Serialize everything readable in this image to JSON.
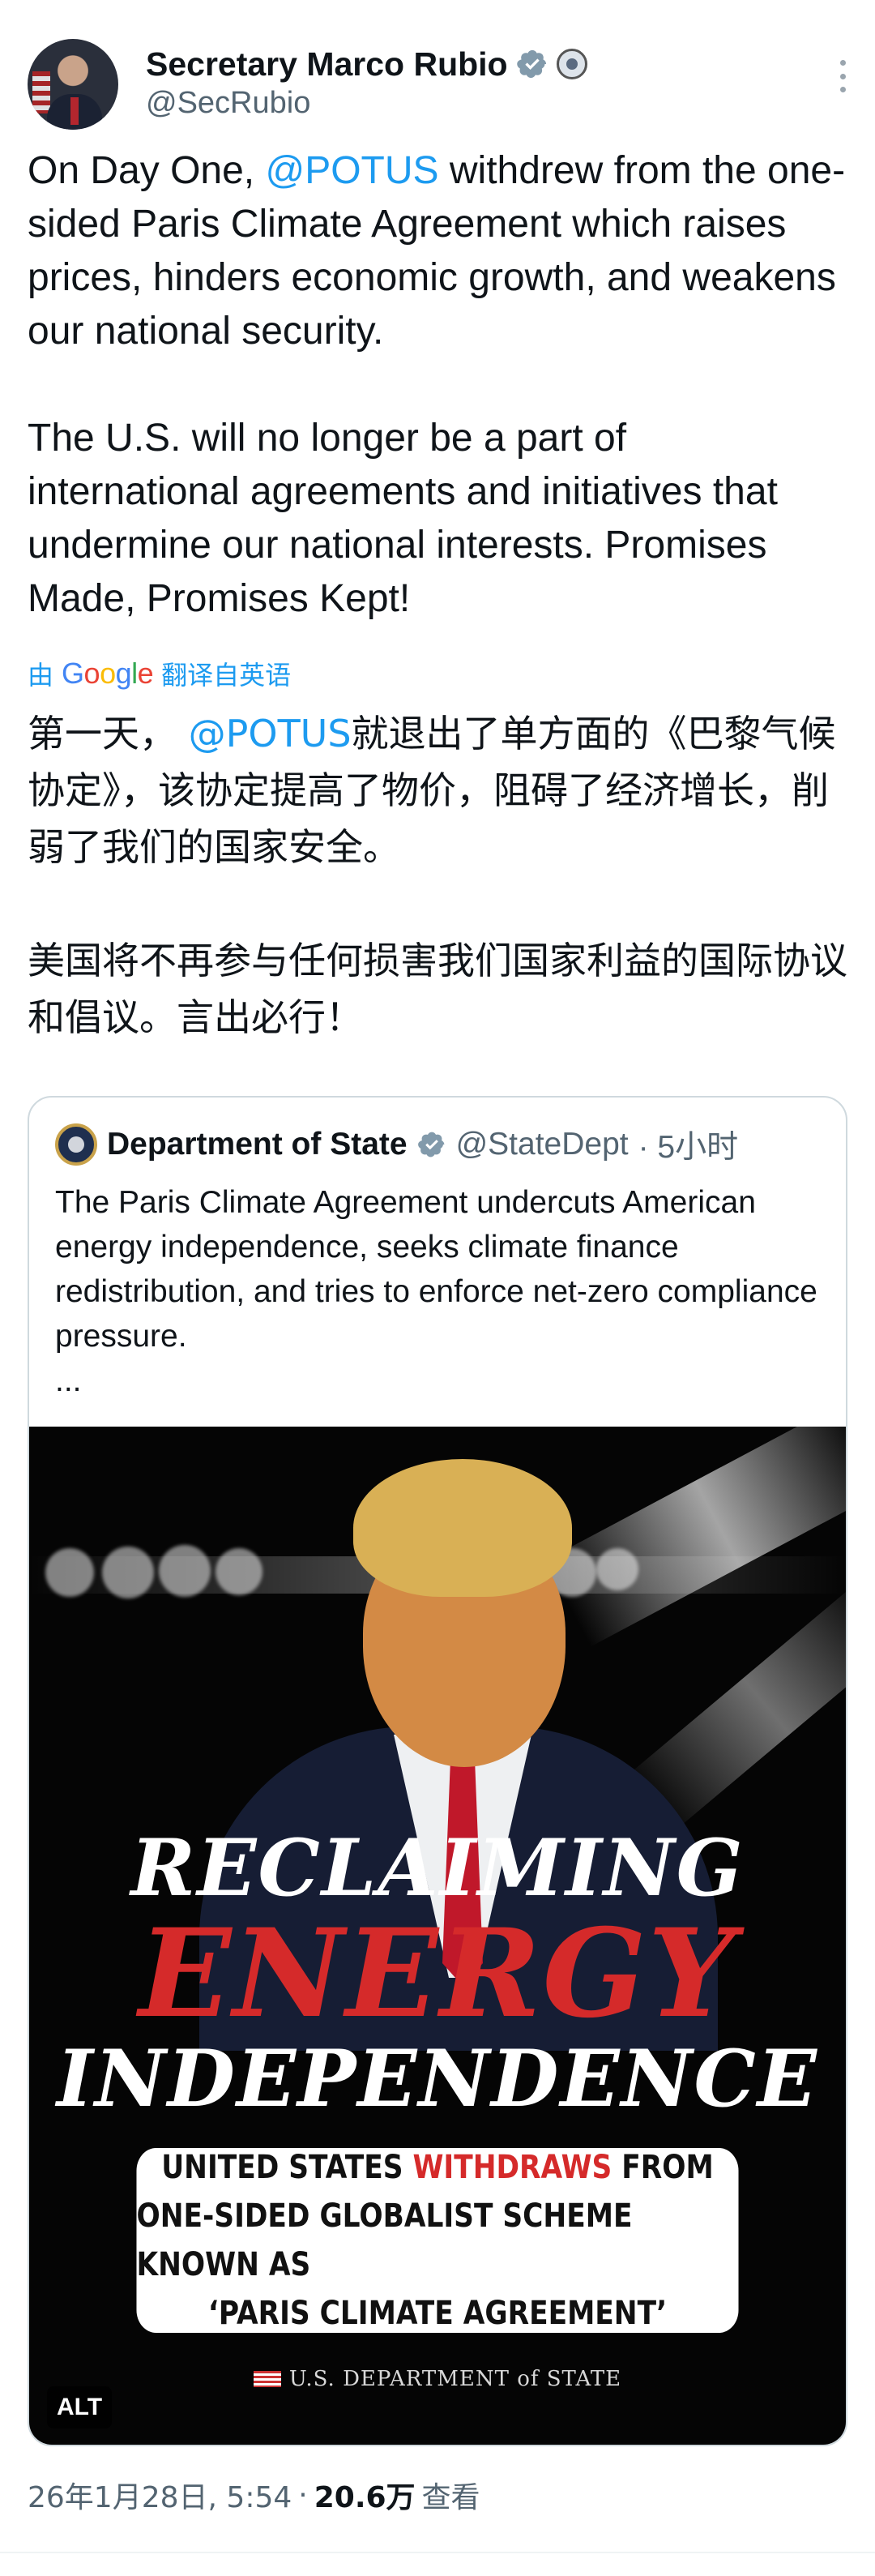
{
  "author": {
    "name": "Secretary Marco Rubio",
    "handle": "@SecRubio"
  },
  "tweet": {
    "line1_pre": "On Day One, ",
    "mention": "@POTUS",
    "line1_post": " withdrew from the one-sided Paris Climate Agreement which raises prices, hinders economic growth, and weakens our national security.\n\nThe U.S. will no longer be a part of international agreements and initiatives that undermine our national interests. Promises Made, Promises Kept!"
  },
  "translation": {
    "by": "由",
    "google": "Google",
    "label": "翻译自英语"
  },
  "translated_text": {
    "pre": "第一天， ",
    "mention": "@POTUS",
    "post": "就退出了单方面的《巴黎气候协定》，该协定提高了物价，阻碍了经济增长，削弱了我们的国家安全。\n\n美国将不再参与任何损害我们国家利益的国际协议和倡议。言出必行！"
  },
  "quoted": {
    "name": "Department of State",
    "handle": "@StateDept",
    "time": "· 5小时",
    "text": "The Paris Climate Agreement undercuts American energy independence, seeks climate finance redistribution, and tries to enforce net-zero compliance pressure.\n...",
    "media": {
      "headline_1": "RECLAIMING",
      "headline_2": "ENERGY",
      "headline_3": "INDEPENDENCE",
      "banner_1_pre": "UNITED STATES ",
      "banner_1_red": "WITHDRAWS",
      "banner_1_post": " FROM",
      "banner_2": "ONE-SIDED GLOBALIST SCHEME KNOWN AS",
      "banner_3": "‘PARIS CLIMATE AGREEMENT’",
      "footer": "U.S. DEPARTMENT of STATE",
      "alt": "ALT"
    }
  },
  "meta": {
    "timestamp": "26年1月28日, 5:54",
    "sep": "·",
    "views": "20.6万",
    "views_label": "查看"
  },
  "colors": {
    "link": "#1d9bf0",
    "accent_red": "#d52a2a",
    "muted": "#536471"
  },
  "icons": [
    "verified-badge-icon",
    "government-seal-icon",
    "more-options-icon",
    "state-dept-seal-icon"
  ]
}
